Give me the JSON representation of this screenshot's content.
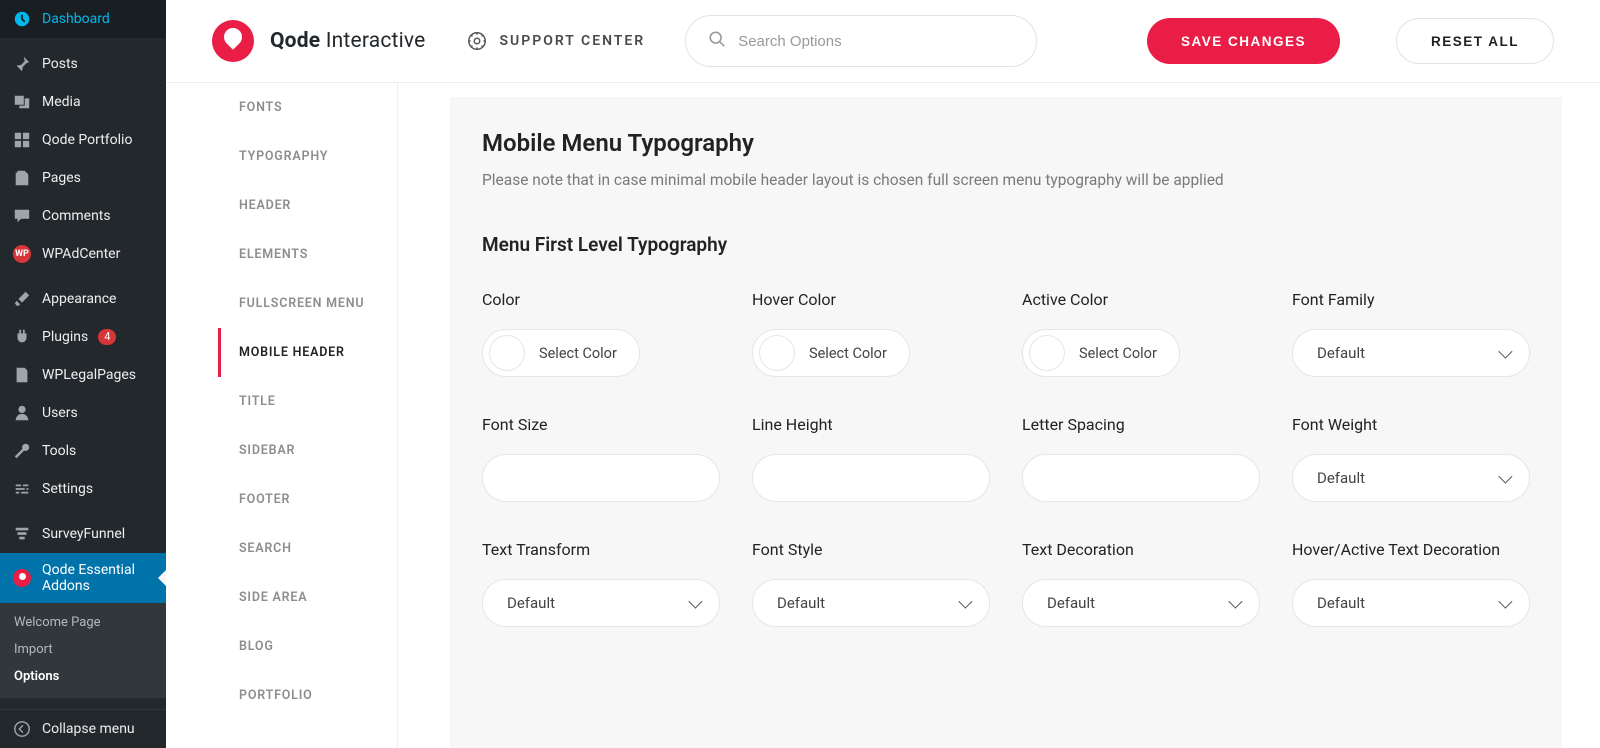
{
  "wp_sidebar": {
    "items": [
      {
        "label": "Dashboard",
        "icon": "dashboard"
      },
      {
        "label": "Posts",
        "icon": "pin"
      },
      {
        "label": "Media",
        "icon": "media"
      },
      {
        "label": "Qode Portfolio",
        "icon": "grid"
      },
      {
        "label": "Pages",
        "icon": "pages"
      },
      {
        "label": "Comments",
        "icon": "comment"
      },
      {
        "label": "WPAdCenter",
        "icon": "wp-red"
      },
      {
        "label": "Appearance",
        "icon": "brush"
      },
      {
        "label": "Plugins",
        "icon": "plug",
        "badge": "4"
      },
      {
        "label": "WPLegalPages",
        "icon": "page"
      },
      {
        "label": "Users",
        "icon": "user"
      },
      {
        "label": "Tools",
        "icon": "wrench"
      },
      {
        "label": "Settings",
        "icon": "sliders"
      },
      {
        "label": "SurveyFunnel",
        "icon": "survey"
      },
      {
        "label": "Qode Essential Addons",
        "icon": "q-red",
        "active": true
      }
    ],
    "submenu": [
      {
        "label": "Welcome Page"
      },
      {
        "label": "Import"
      },
      {
        "label": "Options",
        "current": true
      }
    ],
    "collapse": "Collapse menu"
  },
  "topbar": {
    "brand_bold": "Qode",
    "brand_light": " Interactive",
    "support": "SUPPORT CENTER",
    "search_placeholder": "Search Options",
    "save": "SAVE CHANGES",
    "reset": "RESET ALL"
  },
  "tabs": [
    "FONTS",
    "TYPOGRAPHY",
    "HEADER",
    "ELEMENTS",
    "FULLSCREEN MENU",
    "MOBILE HEADER",
    "TITLE",
    "SIDEBAR",
    "FOOTER",
    "SEARCH",
    "SIDE AREA",
    "BLOG",
    "PORTFOLIO"
  ],
  "tabs_active_index": 5,
  "content": {
    "title": "Mobile Menu Typography",
    "note": "Please note that in case minimal mobile header layout is chosen full screen menu typography will be applied",
    "section_title": "Menu First Level Typography",
    "select_color_label": "Select Color",
    "default_label": "Default",
    "fields_row1": [
      "Color",
      "Hover Color",
      "Active Color",
      "Font Family"
    ],
    "fields_row2": [
      "Font Size",
      "Line Height",
      "Letter Spacing",
      "Font Weight"
    ],
    "fields_row3": [
      "Text Transform",
      "Font Style",
      "Text Decoration",
      "Hover/Active Text Decoration"
    ]
  }
}
